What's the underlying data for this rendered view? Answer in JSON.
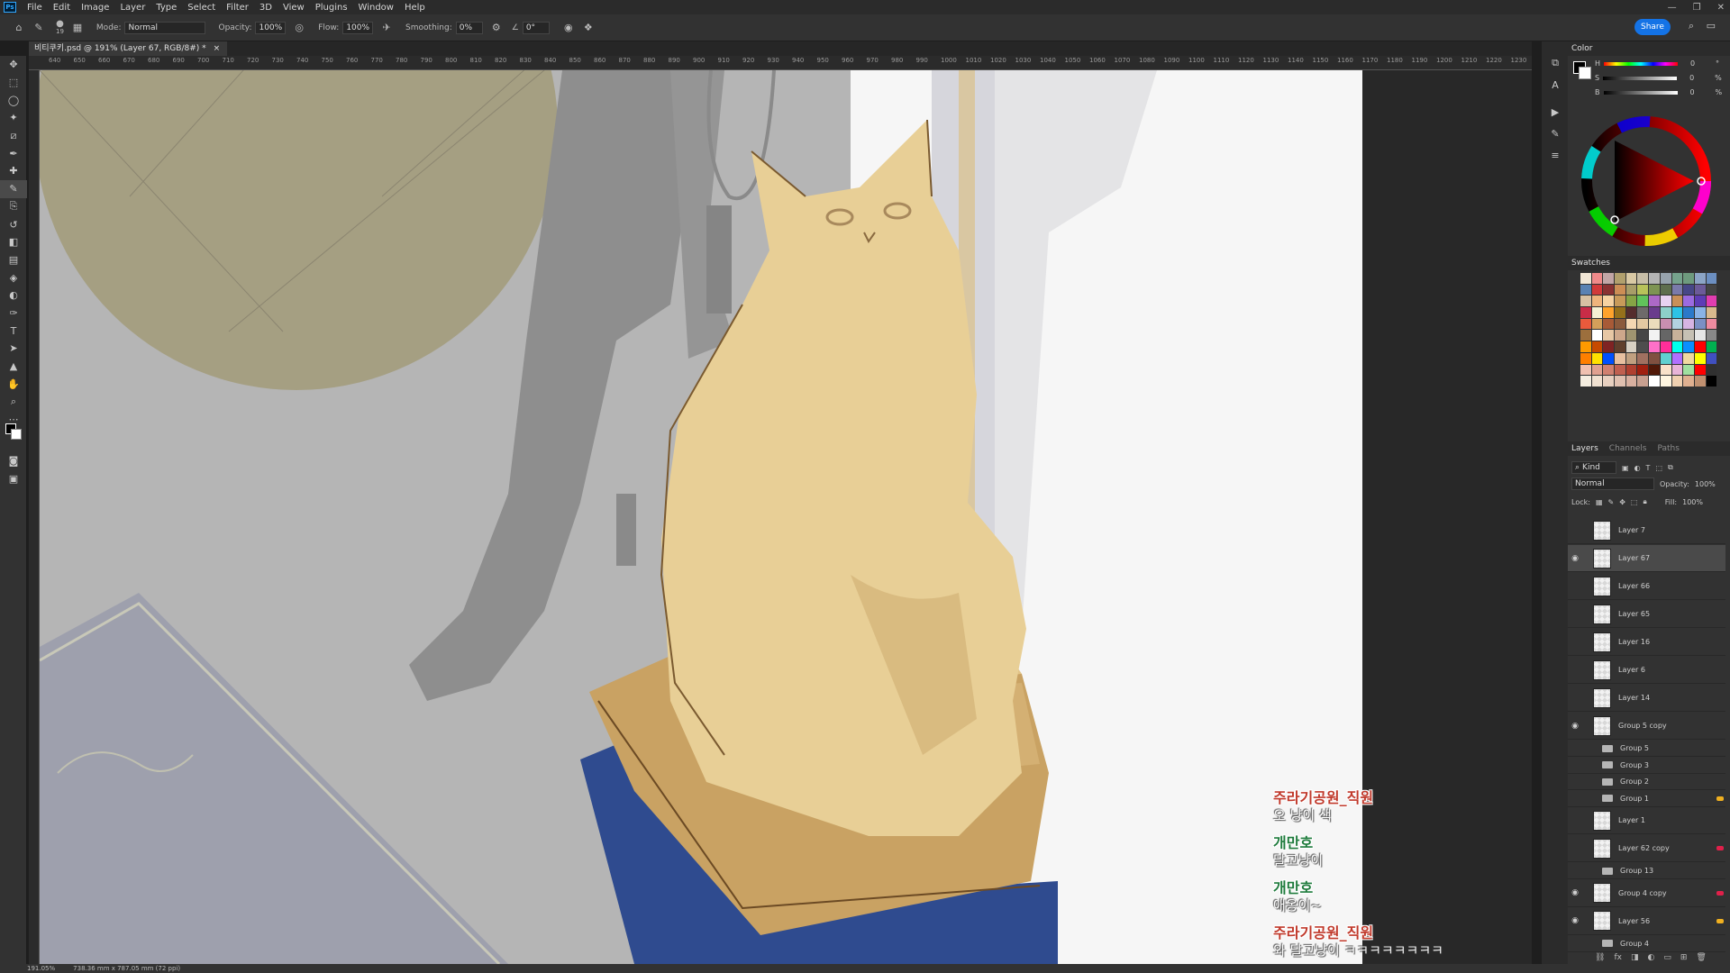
{
  "app": {
    "name": "Photoshop",
    "logo": "Ps"
  },
  "menu": [
    "File",
    "Edit",
    "Image",
    "Layer",
    "Type",
    "Select",
    "Filter",
    "3D",
    "View",
    "Plugins",
    "Window",
    "Help"
  ],
  "window_controls": [
    "minimize",
    "restore",
    "close"
  ],
  "options_bar": {
    "brush_size": "19",
    "mode_label": "Mode:",
    "mode_value": "Normal",
    "opacity_label": "Opacity:",
    "opacity_value": "100%",
    "flow_label": "Flow:",
    "flow_value": "100%",
    "smoothing_label": "Smoothing:",
    "smoothing_value": "0%",
    "angle_value": "0°",
    "share_label": "Share"
  },
  "document_tab": {
    "title": "비티쿠키.psd @ 191% (Layer 67, RGB/8#) *",
    "close": "×"
  },
  "tools": [
    "move-icon",
    "marquee-icon",
    "lasso-icon",
    "magic-wand-icon",
    "crop-icon",
    "eyedropper-icon",
    "healing-icon",
    "brush-icon",
    "clone-stamp-icon",
    "history-brush-icon",
    "eraser-icon",
    "gradient-icon",
    "blur-icon",
    "dodge-icon",
    "pen-icon",
    "type-icon",
    "path-select-icon",
    "shape-icon",
    "hand-icon",
    "zoom-icon",
    "more-tools-icon"
  ],
  "ruler_ticks": [
    "640",
    "650",
    "660",
    "670",
    "680",
    "690",
    "700",
    "710",
    "720",
    "730",
    "740",
    "750",
    "760",
    "770",
    "780",
    "790",
    "800",
    "810",
    "820",
    "830",
    "840",
    "850",
    "860",
    "870",
    "880",
    "890",
    "900",
    "910",
    "920",
    "930",
    "940",
    "950",
    "960",
    "970",
    "980",
    "990",
    "1000",
    "1010",
    "1020",
    "1030",
    "1040",
    "1050",
    "1060",
    "1070",
    "1080",
    "1090",
    "1100",
    "1110",
    "1120",
    "1130",
    "1140",
    "1150",
    "1160",
    "1170",
    "1180",
    "1190",
    "1200",
    "1210",
    "1220",
    "1230"
  ],
  "color_panel": {
    "title": "Color",
    "sliders": [
      {
        "label": "H",
        "value": "0"
      },
      {
        "label": "S",
        "value": "0"
      },
      {
        "label": "B",
        "value": "0"
      }
    ],
    "units": [
      "°",
      "%",
      "%"
    ]
  },
  "swatches_panel": {
    "title": "Swatches",
    "colors": [
      "#f2e7d6",
      "#f08a8a",
      "#c2a6a6",
      "#b1a06d",
      "#d9c9a4",
      "#c8bfa8",
      "#b5b5b5",
      "#97a3ad",
      "#76a38d",
      "#6e9b7e",
      "#8ca5c6",
      "#6c8fc1",
      "#5a82b3",
      "#d13a3a",
      "#8a3232",
      "#cc8e55",
      "#a79d68",
      "#b8c25a",
      "#7e9453",
      "#5e6e4d",
      "#7a7aaa",
      "#474787",
      "#6c5a99",
      "#444",
      "#d8c1a3",
      "#efb47c",
      "#f6d2a3",
      "#c89a5a",
      "#86a445",
      "#61c35b",
      "#ad69c6",
      "#e8d3f0",
      "#c98f58",
      "#9b6be0",
      "#5e3cb6",
      "#e03db0",
      "#c92c47",
      "#f5f0d3",
      "#ffa32c",
      "#96701b",
      "#552d2d",
      "#6e6a6a",
      "#6a3b8c",
      "#8dd1c9",
      "#2dc3e6",
      "#2b79c9",
      "#8ab3e6",
      "#d8b98d",
      "#e95a3c",
      "#d4a05a",
      "#a85a37",
      "#8b5a3c",
      "#f4d7b2",
      "#e3c9a2",
      "#ebdcbc",
      "#c98fb0",
      "#b2d1e0",
      "#d5b4e3",
      "#7a90c4",
      "#ee8ba0",
      "#9c6f3d",
      "#ffffff",
      "#e7c7a5",
      "#cda78b",
      "#9f9470",
      "#464646",
      "#f2f2f2",
      "#666666",
      "#c7b19a",
      "#c6c0b4",
      "#e6e6e6",
      "#888888",
      "#ff9a00",
      "#c64a00",
      "#7f2323",
      "#603f2c",
      "#d7d0c3",
      "#4d4d4d",
      "#ff70c8",
      "#ff2e9a",
      "#00ffee",
      "#0a8fff",
      "#ff0000",
      "#00b050",
      "#ff7f00",
      "#ffe000",
      "#0050ff",
      "#e8c0a0",
      "#c0a080",
      "#a07060",
      "#805040",
      "#60d0d0",
      "#b070ff",
      "#f0d8a0",
      "#ffff00",
      "#4050c0",
      "#f0c0b0",
      "#e0a090",
      "#d08070",
      "#c06050",
      "#b04030",
      "#a02010",
      "#501808",
      "#f9e1c9",
      "#e8b4d8",
      "#a0e0a0",
      "#ff0000",
      "#303030",
      "#f5ede0",
      "#f0e0d0",
      "#e8d0c0",
      "#e0c0b0",
      "#d8b0a0",
      "#c8a090",
      "#ffffff",
      "#fff5e0",
      "#f0d0b0",
      "#e0b090",
      "#c09070",
      "#000000"
    ]
  },
  "layers_panel": {
    "tabs": [
      "Layers",
      "Channels",
      "Paths"
    ],
    "filter_label": "Kind",
    "blend_mode": "Normal",
    "opacity_label": "Opacity:",
    "opacity_value": "100%",
    "lock_label": "Lock:",
    "fill_label": "Fill:",
    "fill_value": "100%",
    "layers": [
      {
        "name": "Layer 7",
        "type": "layer",
        "visible": false,
        "selected": false
      },
      {
        "name": "Layer 67",
        "type": "layer",
        "visible": true,
        "selected": true
      },
      {
        "name": "Layer 66",
        "type": "layer",
        "visible": false,
        "selected": false
      },
      {
        "name": "Layer 65",
        "type": "layer",
        "visible": false,
        "selected": false
      },
      {
        "name": "Layer 16",
        "type": "layer",
        "visible": false,
        "selected": false
      },
      {
        "name": "Layer 6",
        "type": "layer",
        "visible": false,
        "selected": false
      },
      {
        "name": "Layer 14",
        "type": "layer",
        "visible": false,
        "selected": false
      },
      {
        "name": "Group 5 copy",
        "type": "layer",
        "visible": true,
        "selected": false
      },
      {
        "name": "Group 5",
        "type": "group",
        "visible": false,
        "selected": false
      },
      {
        "name": "Group 3",
        "type": "group",
        "visible": false,
        "selected": false
      },
      {
        "name": "Group 2",
        "type": "group",
        "visible": false,
        "selected": false
      },
      {
        "name": "Group 1",
        "type": "group",
        "visible": false,
        "selected": false,
        "tag": "#f0b020"
      },
      {
        "name": "Layer 1",
        "type": "layer",
        "visible": false,
        "selected": false
      },
      {
        "name": "Layer 62 copy",
        "type": "layer",
        "visible": false,
        "selected": false,
        "tag": "#e0204a"
      },
      {
        "name": "Group 13",
        "type": "group",
        "visible": false,
        "selected": false
      },
      {
        "name": "Group 4 copy",
        "type": "layer",
        "visible": true,
        "selected": false,
        "tag": "#e0204a"
      },
      {
        "name": "Layer 56",
        "type": "layer",
        "visible": true,
        "selected": false,
        "tag": "#f0b020"
      },
      {
        "name": "Group 4",
        "type": "group",
        "visible": false,
        "selected": false
      }
    ]
  },
  "status": {
    "zoom": "191.05%",
    "dimensions": "738.36 mm x 787.05 mm (72 ppi)"
  },
  "chat": [
    {
      "user": "주라기공원_직원",
      "color": "#c0392b",
      "message": "오 냥이 색"
    },
    {
      "user": "개만호",
      "color": "#1e7b3c",
      "message": "달고냥이"
    },
    {
      "user": "개만호",
      "color": "#1e7b3c",
      "message": "애옹이~"
    },
    {
      "user": "주라기공원_직원",
      "color": "#c0392b",
      "message": "와 달고냥이 ㅋㅋㅋㅋㅋㅋㅋㅋ"
    }
  ],
  "colors": {
    "ui_bg": "#323232",
    "accent": "#1473e6",
    "cat": "#e8cf96",
    "stool_blue": "#2f4b8f"
  }
}
